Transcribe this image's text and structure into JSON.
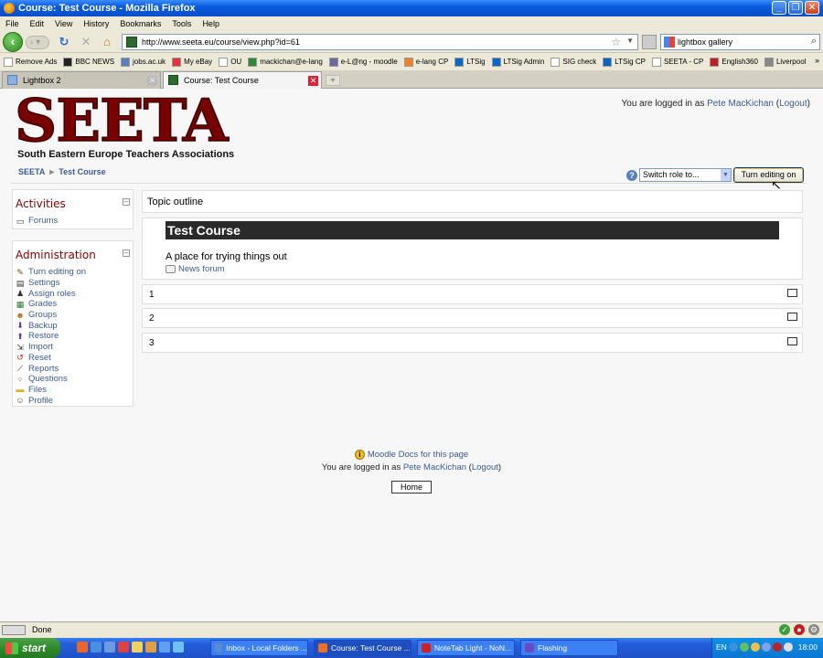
{
  "window": {
    "title": "Course: Test Course - Mozilla Firefox"
  },
  "menu": [
    "File",
    "Edit",
    "View",
    "History",
    "Bookmarks",
    "Tools",
    "Help"
  ],
  "nav": {
    "url": "http://www.seeta.eu/course/view.php?id=61",
    "search": "lightbox gallery"
  },
  "bookmarks": [
    {
      "label": "Remove Ads",
      "icon": "page-icon",
      "color": "#ffffff"
    },
    {
      "label": "BBC NEWS",
      "icon": "bbc-icon",
      "color": "#222222"
    },
    {
      "label": "jobs.ac.uk",
      "icon": "jobs-icon",
      "color": "#5a7fc0"
    },
    {
      "label": "My eBay",
      "icon": "ebay-icon",
      "color": "#e53238"
    },
    {
      "label": "OU",
      "icon": "ou-icon",
      "color": "#ffffff"
    },
    {
      "label": "mackichan@e-lang",
      "icon": "elang-icon",
      "color": "#2a8a3a"
    },
    {
      "label": "e-L@ng - moodle",
      "icon": "moodle-icon",
      "color": "#6a6aa0"
    },
    {
      "label": "e-lang CP",
      "icon": "cp-icon",
      "color": "#f08020"
    },
    {
      "label": "LTSig",
      "icon": "ltsig-icon",
      "color": "#0a66c8"
    },
    {
      "label": "LTSig Admin",
      "icon": "ltsig-admin-icon",
      "color": "#0a66c8"
    },
    {
      "label": "SIG check",
      "icon": "page-icon",
      "color": "#ffffff"
    },
    {
      "label": "LTSig CP",
      "icon": "ltsig-cp-icon",
      "color": "#0a66c8"
    },
    {
      "label": "SEETA - CP",
      "icon": "seeta-icon",
      "color": "#ffffff"
    },
    {
      "label": "English360",
      "icon": "english360-icon",
      "color": "#c02020"
    },
    {
      "label": "Liverpool",
      "icon": "liverpool-icon",
      "color": "#888888"
    }
  ],
  "tabs": [
    {
      "label": "Lightbox 2"
    },
    {
      "label": "Course: Test Course"
    }
  ],
  "site": {
    "logo": "SEETA",
    "logo_sub": "South Eastern Europe Teachers Associations",
    "login_prefix": "You are logged in as",
    "user": "Pete MacKichan",
    "logout": "Logout"
  },
  "breadcrumb": {
    "home": "SEETA",
    "sep": "►",
    "current": "Test Course"
  },
  "controls": {
    "help": "?",
    "switch_role": "Switch role to...",
    "turn_editing": "Turn editing on"
  },
  "activities": {
    "title": "Activities",
    "items": [
      {
        "label": "Forums",
        "icon": "forum-icon"
      }
    ]
  },
  "administration": {
    "title": "Administration",
    "items": [
      {
        "label": "Turn editing on",
        "icon": "edit-icon"
      },
      {
        "label": "Settings",
        "icon": "settings-icon"
      },
      {
        "label": "Assign roles",
        "icon": "roles-icon"
      },
      {
        "label": "Grades",
        "icon": "grades-icon"
      },
      {
        "label": "Groups",
        "icon": "groups-icon"
      },
      {
        "label": "Backup",
        "icon": "backup-icon"
      },
      {
        "label": "Restore",
        "icon": "restore-icon"
      },
      {
        "label": "Import",
        "icon": "import-icon"
      },
      {
        "label": "Reset",
        "icon": "reset-icon"
      },
      {
        "label": "Reports",
        "icon": "reports-icon"
      },
      {
        "label": "Questions",
        "icon": "questions-icon"
      },
      {
        "label": "Files",
        "icon": "files-icon"
      },
      {
        "label": "Profile",
        "icon": "profile-icon"
      }
    ]
  },
  "course": {
    "outline_title": "Topic outline",
    "name": "Test Course",
    "description": "A place for trying things out",
    "forum": "News forum",
    "sections": [
      "1",
      "2",
      "3"
    ]
  },
  "footer": {
    "docs": "Moodle Docs for this page",
    "login_prefix": "You are logged in as",
    "user": "Pete MacKichan",
    "logout": "Logout",
    "home": "Home"
  },
  "status": {
    "text": "Done"
  },
  "taskbar": {
    "start": "start",
    "tasks": [
      {
        "label": "Inbox - Local Folders ...",
        "color": "#5a8ad0"
      },
      {
        "label": "Course: Test Course ...",
        "color": "#f07020"
      },
      {
        "label": "NoteTab Light - NoN...",
        "color": "#d02020"
      },
      {
        "label": "Flashing",
        "color": "#6a4ac0"
      }
    ],
    "lang": "EN",
    "clock": "18:00"
  }
}
